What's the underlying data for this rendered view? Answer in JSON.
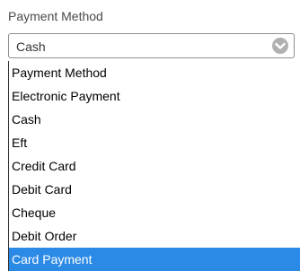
{
  "field": {
    "label": "Payment Method",
    "selected_value": "Cash"
  },
  "icons": {
    "dropdown_toggle": "chevron-down-icon"
  },
  "colors": {
    "highlight": "#2b8ae6",
    "chevron_circle": "#b0b0b0"
  },
  "dropdown": {
    "options": [
      "Payment Method",
      "Electronic Payment",
      "Cash",
      "Eft",
      "Credit Card",
      "Debit Card",
      "Cheque",
      "Debit Order",
      "Card Payment"
    ],
    "highlighted": "Card Payment"
  }
}
